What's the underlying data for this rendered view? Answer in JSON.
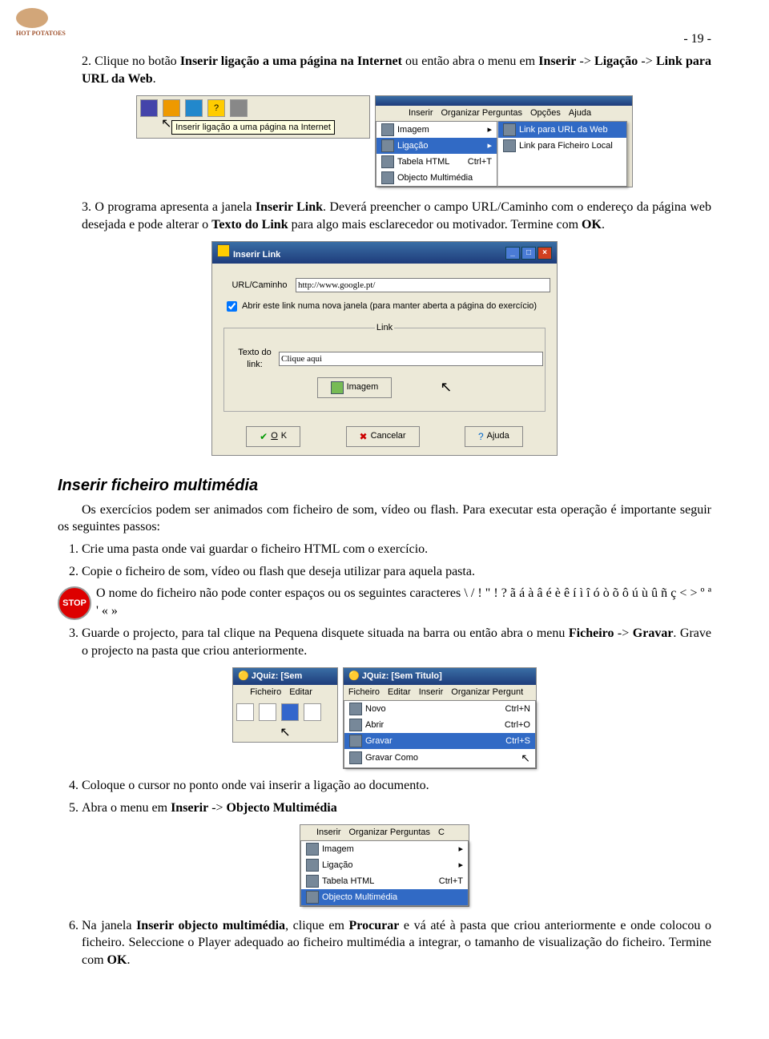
{
  "pagenum": "- 19 -",
  "logo": "HOT POTATOES",
  "p2": {
    "pre": "2.   Clique no botão ",
    "b1": "Inserir ligação a uma página na Internet",
    "mid": " ou então abra o menu em ",
    "b2": "Inserir",
    "arr1": " -> ",
    "b3": "Ligação",
    "arr2": " -> ",
    "b4": "Link para URL da Web",
    "end": "."
  },
  "scr_tool": {
    "tip": "Inserir ligação a uma página na Internet"
  },
  "scr_menu": {
    "bar": [
      "Inserir",
      "Organizar Perguntas",
      "Opções",
      "Ajuda"
    ],
    "items": [
      "Imagem",
      "Ligação",
      "Tabela HTML",
      "Objecto Multimédia"
    ],
    "shortcut": "Ctrl+T",
    "sub": [
      "Link para URL da Web",
      "Link para Ficheiro Local"
    ]
  },
  "p3": {
    "pre": "3.   O programa apresenta a janela ",
    "b1": "Inserir Link",
    "mid": ". Deverá preencher o campo URL/Caminho com o endereço da página web desejada e pode alterar o ",
    "b2": "Texto do Link",
    "mid2": " para algo mais esclarecedor ou motivador. Termine com ",
    "b3": "OK",
    "end": "."
  },
  "dlg": {
    "title": "Inserir Link",
    "url_label": "URL/Caminho",
    "url_value": "http://www.google.pt/",
    "chk": "Abrir este link numa nova janela (para manter aberta a página do exercício)",
    "fset": "Link",
    "link_label": "Texto do link:",
    "link_value": "Clique aqui",
    "img_btn": "Imagem",
    "ok": "OK",
    "cancel": "Cancelar",
    "help": "Ajuda"
  },
  "h2": "Inserir ficheiro multimédia",
  "intro": "Os exercícios podem ser animados com ficheiro de som, vídeo ou flash. Para executar esta operação é importante seguir os seguintes passos:",
  "s1": "Crie uma pasta onde vai guardar o ficheiro HTML com o exercício.",
  "s2": "Copie o ficheiro de som, vídeo ou flash que deseja utilizar para aquela pasta.",
  "stop": "O nome do ficheiro não pode conter espaços ou os seguintes caracteres \\ / ! \" ! ? ã á à â é è ê í ì î ó ò õ ô ú ù û ñ ç < > º ª ' « »",
  "stop_label": "STOP",
  "s3": {
    "pre": "Guarde o projecto, para tal clique na Pequena disquete situada na barra ou então abra o menu ",
    "b1": "Ficheiro",
    "arr": " -> ",
    "b2": "Gravar",
    "end": ". Grave o projecto na pasta que criou anteriormente."
  },
  "scr_save": {
    "title1": "JQuiz: [Sem",
    "title2": "JQuiz: [Sem Titulo]",
    "bar1": [
      "Ficheiro",
      "Editar"
    ],
    "bar2": [
      "Ficheiro",
      "Editar",
      "Inserir",
      "Organizar Pergunt"
    ],
    "items": [
      [
        "Novo",
        "Ctrl+N"
      ],
      [
        "Abrir",
        "Ctrl+O"
      ],
      [
        "Gravar",
        "Ctrl+S"
      ],
      [
        "Gravar Como",
        ""
      ]
    ]
  },
  "s4": "Coloque o cursor no ponto onde vai inserir a ligação ao documento.",
  "s5": {
    "pre": "Abra o menu em ",
    "b1": "Inserir",
    "arr": " -> ",
    "b2": "Objecto Multimédia"
  },
  "scr_obj": {
    "bar": [
      "Inserir",
      "Organizar Perguntas",
      "C"
    ],
    "items": [
      [
        "Imagem",
        ""
      ],
      [
        "Ligação",
        ""
      ],
      [
        "Tabela HTML",
        "Ctrl+T"
      ],
      [
        "Objecto Multimédia",
        ""
      ]
    ]
  },
  "s6": {
    "pre": "Na janela ",
    "b1": "Inserir objecto multimédia",
    "mid": ", clique em ",
    "b2": "Procurar",
    "mid2": " e vá até à pasta que criou anteriormente e onde colocou o ficheiro. Seleccione o Player adequado ao ficheiro multimédia a integrar, o tamanho de visualização do ficheiro. Termine com ",
    "b3": "OK",
    "end": "."
  }
}
